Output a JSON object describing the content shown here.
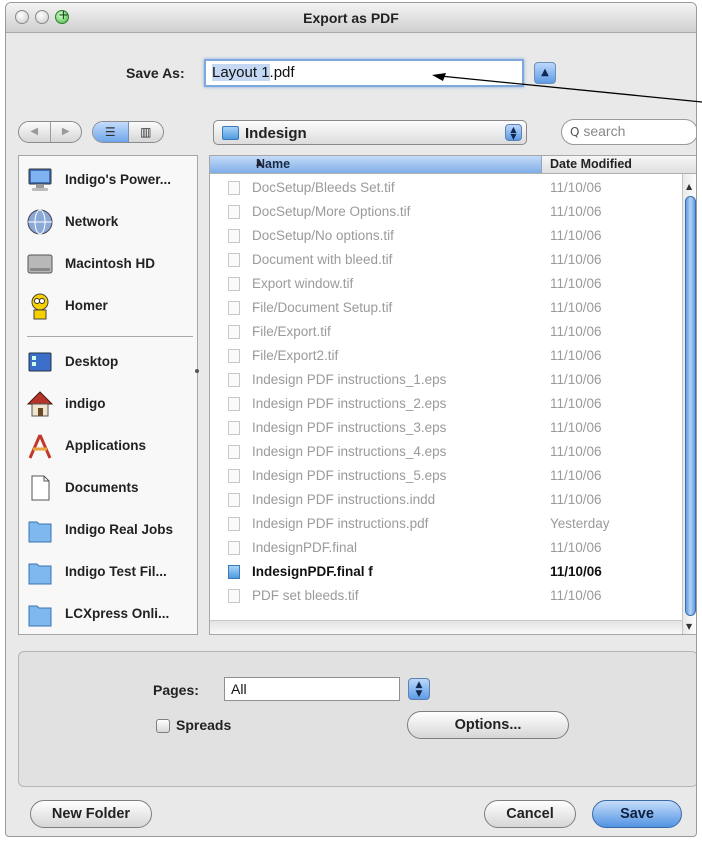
{
  "window": {
    "title": "Export as PDF"
  },
  "save_as": {
    "label": "Save As:",
    "value_selected": "Layout 1",
    "value_ext": ".pdf"
  },
  "toolbar": {
    "back_glyph": "◀",
    "forward_glyph": "▶",
    "list_view_glyph": "☰",
    "column_view_glyph": "▥",
    "location": "Indesign",
    "search_placeholder": "search",
    "search_glyph": "Q"
  },
  "sidebar": {
    "devices": [
      {
        "label": "Indigo's Power...",
        "icon": "computer-icon"
      },
      {
        "label": "Network",
        "icon": "network-globe-icon"
      },
      {
        "label": "Macintosh HD",
        "icon": "hard-drive-icon"
      },
      {
        "label": "Homer",
        "icon": "homer-icon"
      }
    ],
    "places": [
      {
        "label": "Desktop",
        "icon": "desktop-icon"
      },
      {
        "label": "indigo",
        "icon": "home-icon"
      },
      {
        "label": "Applications",
        "icon": "applications-icon"
      },
      {
        "label": "Documents",
        "icon": "documents-icon"
      },
      {
        "label": "Indigo Real Jobs",
        "icon": "folder-icon"
      },
      {
        "label": "Indigo Test Fil...",
        "icon": "folder-icon"
      },
      {
        "label": "LCXpress Onli...",
        "icon": "folder-icon"
      }
    ]
  },
  "file_list": {
    "columns": {
      "name": "Name",
      "date": "Date Modified"
    },
    "rows": [
      {
        "name": "DocSetup/Bleeds Set.tif",
        "date": "11/10/06",
        "enabled": false
      },
      {
        "name": "DocSetup/More Options.tif",
        "date": "11/10/06",
        "enabled": false
      },
      {
        "name": "DocSetup/No options.tif",
        "date": "11/10/06",
        "enabled": false
      },
      {
        "name": "Document with bleed.tif",
        "date": "11/10/06",
        "enabled": false
      },
      {
        "name": "Export window.tif",
        "date": "11/10/06",
        "enabled": false
      },
      {
        "name": "File/Document Setup.tif",
        "date": "11/10/06",
        "enabled": false
      },
      {
        "name": "File/Export.tif",
        "date": "11/10/06",
        "enabled": false
      },
      {
        "name": "File/Export2.tif",
        "date": "11/10/06",
        "enabled": false
      },
      {
        "name": "Indesign PDF instructions_1.eps",
        "date": "11/10/06",
        "enabled": false
      },
      {
        "name": "Indesign PDF instructions_2.eps",
        "date": "11/10/06",
        "enabled": false
      },
      {
        "name": "Indesign PDF instructions_3.eps",
        "date": "11/10/06",
        "enabled": false
      },
      {
        "name": "Indesign PDF instructions_4.eps",
        "date": "11/10/06",
        "enabled": false
      },
      {
        "name": "Indesign PDF instructions_5.eps",
        "date": "11/10/06",
        "enabled": false
      },
      {
        "name": "Indesign PDF instructions.indd",
        "date": "11/10/06",
        "enabled": false
      },
      {
        "name": "Indesign PDF instructions.pdf",
        "date": "Yesterday",
        "enabled": false
      },
      {
        "name": "IndesignPDF.final",
        "date": "11/10/06",
        "enabled": false
      },
      {
        "name": "IndesignPDF.final f",
        "date": "11/10/06",
        "enabled": true
      },
      {
        "name": "PDF set bleeds.tif",
        "date": "11/10/06",
        "enabled": false
      }
    ]
  },
  "options": {
    "pages_label": "Pages:",
    "pages_value": "All",
    "spreads_label": "Spreads",
    "spreads_checked": false,
    "options_button": "Options..."
  },
  "buttons": {
    "new_folder": "New Folder",
    "cancel": "Cancel",
    "save": "Save"
  },
  "colors": {
    "accent": "#5e9be6",
    "selection": "#c4d8f3",
    "disabled_text": "#9a9a9a"
  }
}
